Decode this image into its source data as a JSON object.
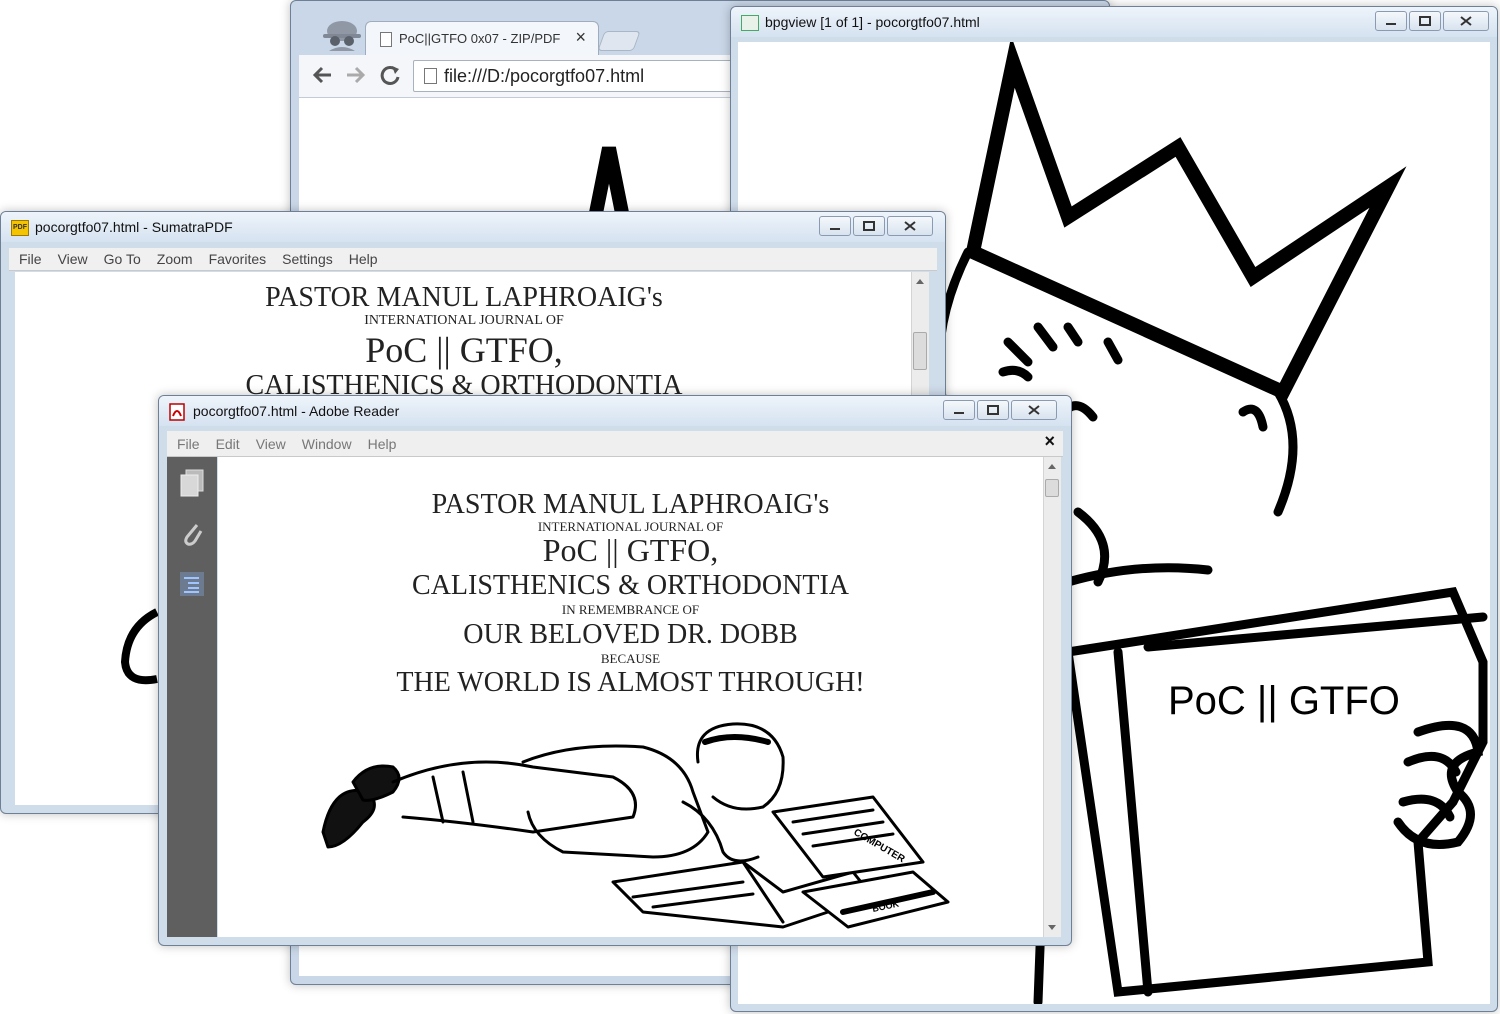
{
  "chrome": {
    "tab_title": "PoC||GTFO 0x07 - ZIP/PDF",
    "tab_close": "×",
    "address": "file:///D:/pocorgtfo07.html"
  },
  "bpgview": {
    "title": "bpgview [1 of 1] - pocorgtfo07.html",
    "book_text": "PoC || GTFO"
  },
  "sumatra": {
    "title": "pocorgtfo07.html - SumatraPDF",
    "icon_text": "PDF",
    "menu": [
      "File",
      "View",
      "Go To",
      "Zoom",
      "Favorites",
      "Settings",
      "Help"
    ],
    "lines": [
      "PASTOR MANUL LAPHROAIG's",
      "INTERNATIONAL JOURNAL OF",
      "PoC || GTFO,",
      "CALISTHENICS & ORTHODONTIA"
    ]
  },
  "reader": {
    "title": "pocorgtfo07.html - Adobe Reader",
    "menu": [
      "File",
      "Edit",
      "View",
      "Window",
      "Help"
    ],
    "close_doc": "×",
    "lines": [
      "PASTOR MANUL LAPHROAIG's",
      "INTERNATIONAL JOURNAL OF",
      "PoC || GTFO,",
      "CALISTHENICS & ORTHODONTIA",
      "IN REMEMBRANCE OF",
      "OUR BELOVED DR. DOBB",
      "BECAUSE",
      "THE WORLD IS ALMOST THROUGH!"
    ],
    "magazine_text": "COMPUTER",
    "book_text": "BOOK"
  }
}
